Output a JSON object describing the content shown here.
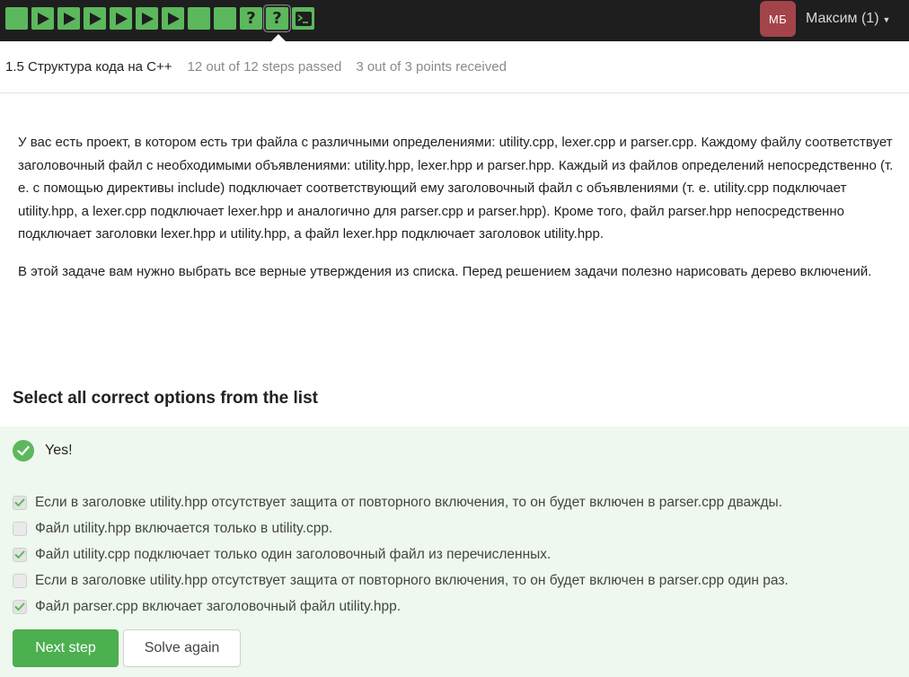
{
  "steps": [
    {
      "kind": "passed"
    },
    {
      "kind": "video"
    },
    {
      "kind": "video"
    },
    {
      "kind": "video"
    },
    {
      "kind": "video"
    },
    {
      "kind": "video"
    },
    {
      "kind": "video"
    },
    {
      "kind": "passed"
    },
    {
      "kind": "passed"
    },
    {
      "kind": "quiz",
      "label": "?"
    },
    {
      "kind": "quiz",
      "label": "?",
      "current": true
    },
    {
      "kind": "code"
    }
  ],
  "user": {
    "initials": "МБ",
    "name": "Максим (1)",
    "avatar_color": "#a3434a"
  },
  "lesson": {
    "title": "1.5 Структура кода на C++",
    "steps_passed": "12 out of 12 steps passed",
    "points": "3 out of 3 points  received"
  },
  "task": {
    "paragraphs": [
      "У вас есть проект, в котором есть три файла с различными определениями: utility.cpp, lexer.cpp и parser.cpp. Каждому файлу соответствует заголовочный файл с необходимыми объявлениями: utility.hpp, lexer.hpp и parser.hpp. Каждый из файлов определений непосредственно (т. е. с помощью директивы include) подключает соответствующий ему заголовочный файл с объявлениями (т. е. utility.cpp подключает utility.hpp, а lexer.cpp подключает lexer.hpp и аналогично для parser.cpp и parser.hpp). Кроме того, файл parser.hpp непосредственно подключает заголовки lexer.hpp и utility.hpp, а файл lexer.hpp подключает заголовок utility.hpp.",
      "В этой задаче вам нужно выбрать все верные утверждения из списка. Перед решением задачи полезно нарисовать дерево включений."
    ]
  },
  "question": {
    "heading": "Select all correct options from the list"
  },
  "feedback": {
    "verdict": "Yes!",
    "accent": "#5cb85c",
    "background": "#eef8ee"
  },
  "options": [
    {
      "text": "Если в заголовке utility.hpp отсутствует защита от повторного включения, то он будет включен в parser.cpp дважды.",
      "checked": true
    },
    {
      "text": "Файл utility.hpp включается только в utility.cpp.",
      "checked": false
    },
    {
      "text": "Файл utility.cpp подключает только один заголовочный файл из перечисленных.",
      "checked": true
    },
    {
      "text": "Если в заголовке utility.hpp отсутствует защита от повторного включения, то он будет включен в parser.cpp один раз.",
      "checked": false
    },
    {
      "text": "Файл parser.cpp включает заголовочный файл utility.hpp.",
      "checked": true
    }
  ],
  "buttons": {
    "next": "Next step",
    "solve_again": "Solve again"
  }
}
